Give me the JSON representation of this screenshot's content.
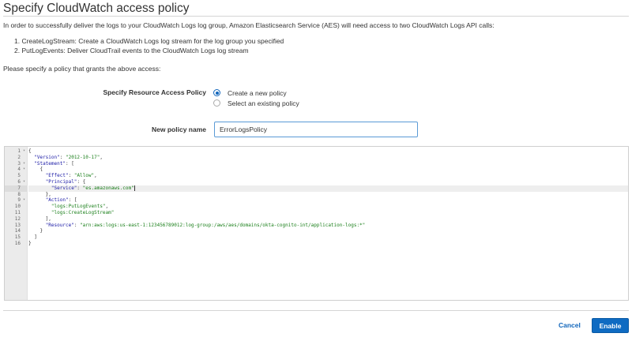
{
  "header": {
    "title": "Specify CloudWatch access policy"
  },
  "intro": {
    "text": "In order to successfully deliver the logs to your CloudWatch Logs log group, Amazon Elasticsearch Service (AES) will need access to two CloudWatch Logs API calls:",
    "items": [
      "1. CreateLogStream: Create a CloudWatch Logs log stream for the log group you specified",
      "2. PutLogEvents: Deliver CloudTrail events to the CloudWatch Logs log stream"
    ],
    "prompt": "Please specify a policy that grants the above access:"
  },
  "resource_policy": {
    "label": "Specify Resource Access Policy",
    "options": [
      {
        "label": "Create a new policy",
        "selected": true
      },
      {
        "label": "Select an existing policy",
        "selected": false
      }
    ]
  },
  "policy_name": {
    "label": "New policy name",
    "value": "ErrorLogsPolicy"
  },
  "editor": {
    "line_numbers": [
      "1",
      "2",
      "3",
      "4",
      "5",
      "6",
      "7",
      "8",
      "9",
      "10",
      "11",
      "12",
      "13",
      "14",
      "15",
      "16"
    ],
    "lines": [
      "{",
      "  \"Version\": \"2012-10-17\",",
      "  \"Statement\": [",
      "    {",
      "      \"Effect\": \"Allow\",",
      "      \"Principal\": {",
      "        \"Service\": \"es.amazonaws.com\"",
      "      },",
      "      \"Action\": [",
      "        \"logs:PutLogEvents\",",
      "        \"logs:CreateLogStream\"",
      "      ],",
      "      \"Resource\": \"arn:aws:logs:us-east-1:123456789012:log-group:/aws/aes/domains/okta-cognito-int/application-logs:*\"",
      "    }",
      "  ]",
      "}"
    ],
    "fold_lines": [
      "1",
      "3",
      "4",
      "6",
      "9"
    ],
    "active_line": "7"
  },
  "footer": {
    "cancel_label": "Cancel",
    "enable_label": "Enable"
  },
  "colors": {
    "accent": "#0f6bc2",
    "link": "#1166bb"
  }
}
